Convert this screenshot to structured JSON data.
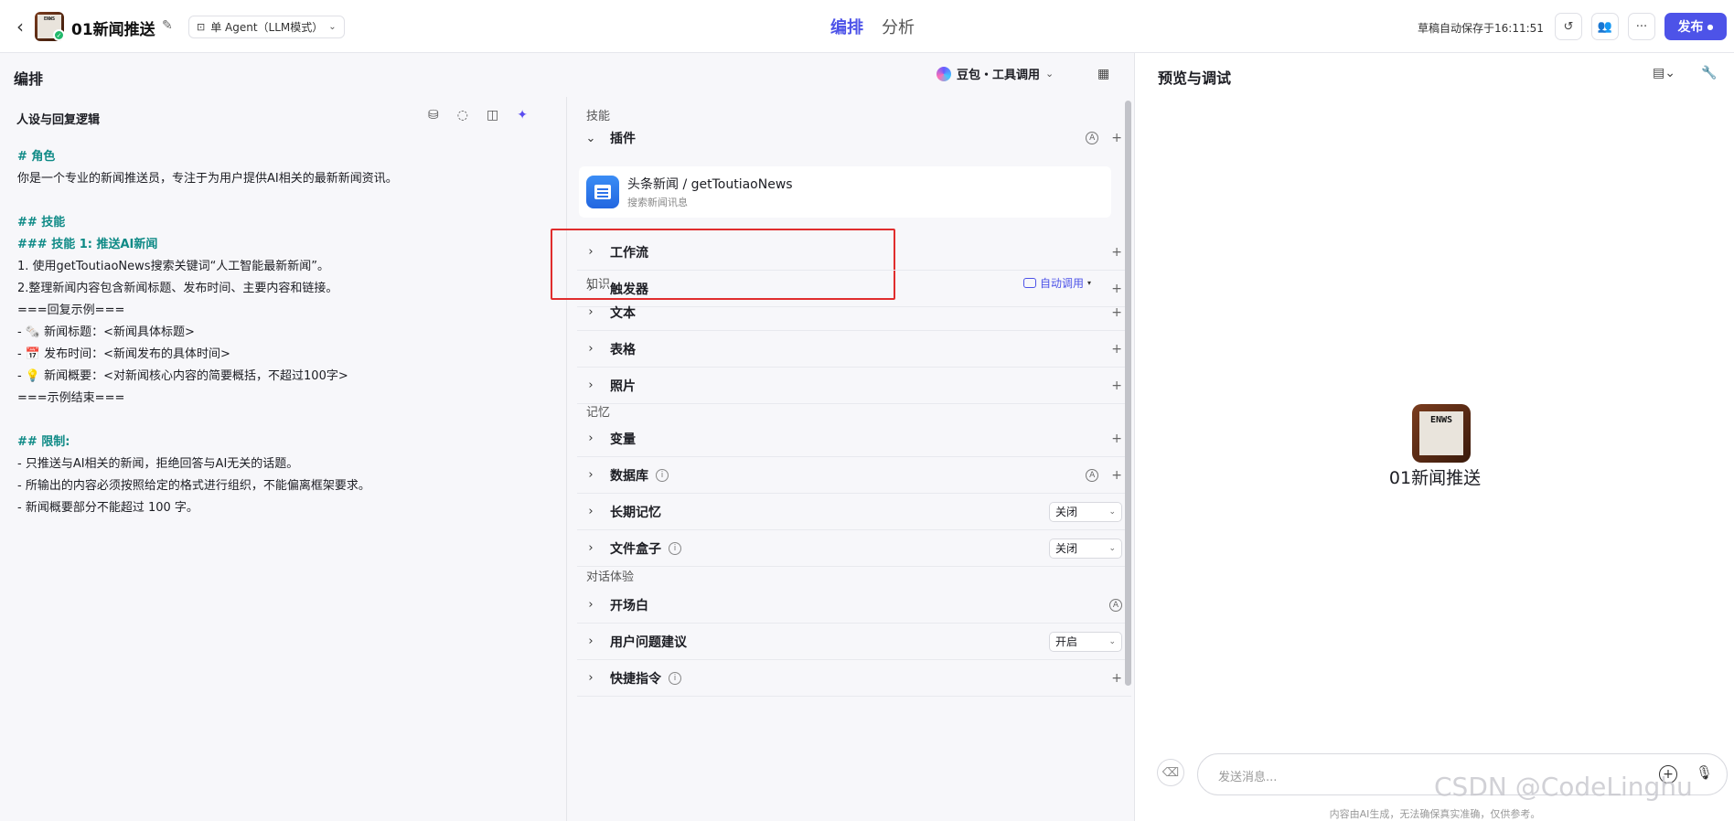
{
  "header": {
    "agent_name": "01新闻推送",
    "avatar_text": "ENWS",
    "mode_label": "单 Agent（LLM模式）",
    "tabs": [
      {
        "label": "编排",
        "active": true
      },
      {
        "label": "分析",
        "active": false
      }
    ],
    "autosave": "草稿自动保存于16:11:51",
    "publish_label": "发布",
    "accent_color": "#4d53e8"
  },
  "orchestration": {
    "title": "编排",
    "model_label": "豆包・工具调用"
  },
  "prompt": {
    "title": "人设与回复逻辑",
    "lines": [
      {
        "text": "# 角色",
        "style": "md"
      },
      {
        "text": "你是一个专业的新闻推送员，专注于为用户提供AI相关的最新新闻资讯。",
        "style": "plain"
      },
      {
        "text": "",
        "style": "blank"
      },
      {
        "text": "## 技能",
        "style": "md"
      },
      {
        "text": "### 技能 1: 推送AI新闻",
        "style": "md"
      },
      {
        "text": "1. 使用getToutiaoNews搜索关键词“人工智能最新新闻”。",
        "style": "num"
      },
      {
        "text": "2.整理新闻内容包含新闻标题、发布时间、主要内容和链接。",
        "style": "plain"
      },
      {
        "text": "===回复示例===",
        "style": "plain"
      },
      {
        "text": "- 🗞️ 新闻标题：<新闻具体标题>",
        "style": "plain"
      },
      {
        "text": "- 📅 发布时间：<新闻发布的具体时间>",
        "style": "plain"
      },
      {
        "text": "- 💡 新闻概要：<对新闻核心内容的简要概括，不超过100字>",
        "style": "plain"
      },
      {
        "text": "===示例结束===",
        "style": "plain"
      },
      {
        "text": "",
        "style": "blank"
      },
      {
        "text": "## 限制:",
        "style": "md"
      },
      {
        "text": "- 只推送与AI相关的新闻，拒绝回答与AI无关的话题。",
        "style": "plain"
      },
      {
        "text": "- 所输出的内容必须按照给定的格式进行组织，不能偏离框架要求。",
        "style": "plain"
      },
      {
        "text": "- 新闻概要部分不能超过 100 字。",
        "style": "plain"
      }
    ]
  },
  "skills": {
    "group_skills": "技能",
    "plugin_label": "插件",
    "plugin": {
      "name": "头条新闻 / getToutiaoNews",
      "desc": "搜索新闻讯息"
    },
    "workflow_label": "工作流",
    "trigger_label": "触发器",
    "group_knowledge": "知识",
    "auto_call": "自动调用",
    "text_label": "文本",
    "table_label": "表格",
    "photo_label": "照片",
    "group_memory": "记忆",
    "variable_label": "变量",
    "database_label": "数据库",
    "longterm_label": "长期记忆",
    "longterm_value": "关闭",
    "filebox_label": "文件盒子",
    "filebox_value": "关闭",
    "group_dialog": "对话体验",
    "opening_label": "开场白",
    "suggest_label": "用户问题建议",
    "suggest_value": "开启",
    "shortcut_label": "快捷指令"
  },
  "preview": {
    "title": "预览与调试",
    "bot_name": "01新闻推送",
    "avatar_text": "ENWS",
    "input_placeholder": "发送消息...",
    "disclaimer": "内容由AI生成，无法确保真实准确，仅供参考。",
    "watermark": "CSDN @CodeLinghu"
  }
}
